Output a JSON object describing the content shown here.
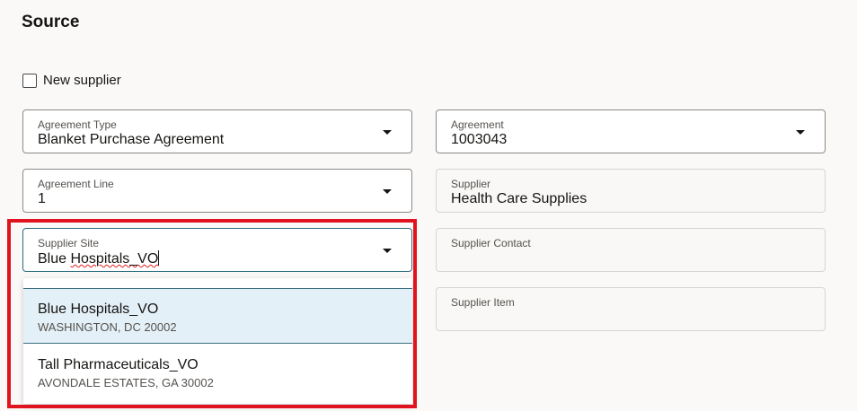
{
  "section_title": "Source",
  "new_supplier": {
    "label": "New supplier",
    "checked": false
  },
  "fields": {
    "agreement_type": {
      "label": "Agreement Type",
      "value": "Blanket Purchase Agreement"
    },
    "agreement": {
      "label": "Agreement",
      "value": "1003043"
    },
    "agreement_line": {
      "label": "Agreement Line",
      "value": "1"
    },
    "supplier": {
      "label": "Supplier",
      "value": "Health Care Supplies"
    },
    "supplier_site": {
      "label": "Supplier Site",
      "value_a": "Blue ",
      "value_b": "Hospitals_VO"
    },
    "supplier_contact": {
      "label": "Supplier Contact",
      "value": ""
    },
    "supplier_item": {
      "label": "Supplier Item",
      "value": ""
    }
  },
  "site_options": [
    {
      "name": "Blue Hospitals_VO",
      "address": "WASHINGTON, DC 20002"
    },
    {
      "name": "Tall Pharmaceuticals_VO",
      "address": "AVONDALE ESTATES, GA 30002"
    }
  ],
  "colors": {
    "highlight_box": "#e0141e",
    "selected_option": "#e4f0f7",
    "focus": "#2c6b7f"
  }
}
